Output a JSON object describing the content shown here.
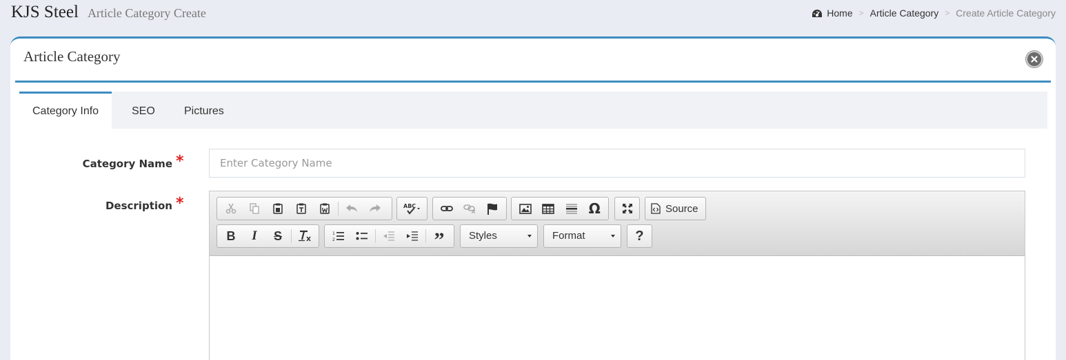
{
  "header": {
    "site_name": "KJS Steel",
    "page_subtitle": "Article Category Create"
  },
  "breadcrumb": {
    "home": "Home",
    "section": "Article Category",
    "current": "Create Article Category",
    "separator": ">"
  },
  "portlet": {
    "title": "Article Category"
  },
  "tabs": [
    {
      "label": "Category Info",
      "active": true
    },
    {
      "label": "SEO",
      "active": false
    },
    {
      "label": "Pictures",
      "active": false
    }
  ],
  "form": {
    "category_name": {
      "label": "Category Name",
      "required_mark": "*",
      "value": "",
      "placeholder": "Enter Category Name"
    },
    "description": {
      "label": "Description",
      "required_mark": "*"
    }
  },
  "editor": {
    "source_label": "Source",
    "styles_label": "Styles",
    "format_label": "Format",
    "help_label": "?",
    "icons_row1": [
      "cut-icon",
      "copy-icon",
      "paste-icon",
      "paste-text-icon",
      "paste-word-icon",
      "undo-icon",
      "redo-icon",
      "spellcheck-icon",
      "link-icon",
      "unlink-icon",
      "anchor-icon",
      "image-icon",
      "table-icon",
      "horizontal-rule-icon",
      "special-char-icon",
      "maximize-icon",
      "source-icon"
    ],
    "icons_row2": [
      "bold-icon",
      "italic-icon",
      "strike-icon",
      "remove-format-icon",
      "numbered-list-icon",
      "bullet-list-icon",
      "outdent-icon",
      "indent-icon",
      "blockquote-icon"
    ]
  },
  "colors": {
    "accent": "#3d8cc1",
    "required": "#e02222",
    "background": "#e9ecf3"
  }
}
